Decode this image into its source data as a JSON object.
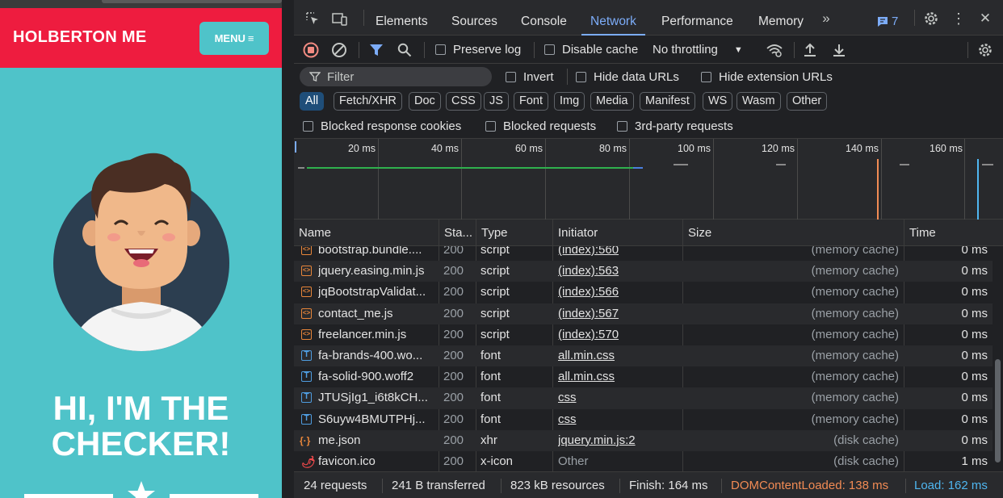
{
  "page": {
    "brand": "HOLBERTON ME",
    "menu_label": "MENU",
    "hero_line1": "HI, I'M THE",
    "hero_line2": "CHECKER!"
  },
  "devtools": {
    "tabs": [
      "Elements",
      "Sources",
      "Console",
      "Network",
      "Performance",
      "Memory"
    ],
    "active_tab": "Network",
    "message_count": "7",
    "toolbar": {
      "preserve_log": "Preserve log",
      "disable_cache": "Disable cache",
      "throttling": "No throttling"
    },
    "filter": {
      "placeholder": "Filter",
      "invert": "Invert",
      "hide_data_urls": "Hide data URLs",
      "hide_extension_urls": "Hide extension URLs"
    },
    "type_filters": [
      "All",
      "Fetch/XHR",
      "Doc",
      "CSS",
      "JS",
      "Font",
      "Img",
      "Media",
      "Manifest",
      "WS",
      "Wasm",
      "Other"
    ],
    "active_type_filter": "All",
    "block_options": {
      "blocked_response_cookies": "Blocked response cookies",
      "blocked_requests": "Blocked requests",
      "third_party_requests": "3rd-party requests"
    },
    "timeline_ticks": [
      "20 ms",
      "40 ms",
      "60 ms",
      "80 ms",
      "100 ms",
      "120 ms",
      "140 ms",
      "160 ms"
    ],
    "columns": {
      "name": "Name",
      "status": "Sta...",
      "type": "Type",
      "initiator": "Initiator",
      "size": "Size",
      "time": "Time"
    },
    "rows": [
      {
        "name": "bootstrap.bundle....",
        "status": "200",
        "type": "script",
        "initiator": "(index):560",
        "size": "(memory cache)",
        "time": "0 ms",
        "icon": "script-icon"
      },
      {
        "name": "jquery.easing.min.js",
        "status": "200",
        "type": "script",
        "initiator": "(index):563",
        "size": "(memory cache)",
        "time": "0 ms",
        "icon": "script-icon"
      },
      {
        "name": "jqBootstrapValidat...",
        "status": "200",
        "type": "script",
        "initiator": "(index):566",
        "size": "(memory cache)",
        "time": "0 ms",
        "icon": "script-icon"
      },
      {
        "name": "contact_me.js",
        "status": "200",
        "type": "script",
        "initiator": "(index):567",
        "size": "(memory cache)",
        "time": "0 ms",
        "icon": "script-icon"
      },
      {
        "name": "freelancer.min.js",
        "status": "200",
        "type": "script",
        "initiator": "(index):570",
        "size": "(memory cache)",
        "time": "0 ms",
        "icon": "script-icon"
      },
      {
        "name": "fa-brands-400.wo...",
        "status": "200",
        "type": "font",
        "initiator": "all.min.css",
        "size": "(memory cache)",
        "time": "0 ms",
        "icon": "font-icon"
      },
      {
        "name": "fa-solid-900.woff2",
        "status": "200",
        "type": "font",
        "initiator": "all.min.css",
        "size": "(memory cache)",
        "time": "0 ms",
        "icon": "font-icon"
      },
      {
        "name": "JTUSjIg1_i6t8kCH...",
        "status": "200",
        "type": "font",
        "initiator": "css",
        "size": "(memory cache)",
        "time": "0 ms",
        "icon": "font-icon"
      },
      {
        "name": "S6uyw4BMUTPHj...",
        "status": "200",
        "type": "font",
        "initiator": "css",
        "size": "(memory cache)",
        "time": "0 ms",
        "icon": "font-icon"
      },
      {
        "name": "me.json",
        "status": "200",
        "type": "xhr",
        "initiator": "jquery.min.js:2",
        "size": "(disk cache)",
        "time": "0 ms",
        "icon": "xhr-icon"
      },
      {
        "name": "favicon.ico",
        "status": "200",
        "type": "x-icon",
        "initiator": "Other",
        "size": "(disk cache)",
        "time": "1 ms",
        "icon": "favicon-icon"
      }
    ],
    "status": {
      "requests": "24 requests",
      "transferred": "241 B transferred",
      "resources": "823 kB resources",
      "finish": "Finish: 164 ms",
      "dom_content_loaded": "DOMContentLoaded: 138 ms",
      "load": "Load: 162 ms"
    },
    "colors": {
      "accent": "#7cacf8",
      "dcl": "#f28b54",
      "load": "#4fb6f0",
      "brand_red": "#ee1c3f",
      "page_teal": "#4fc3c9"
    }
  }
}
